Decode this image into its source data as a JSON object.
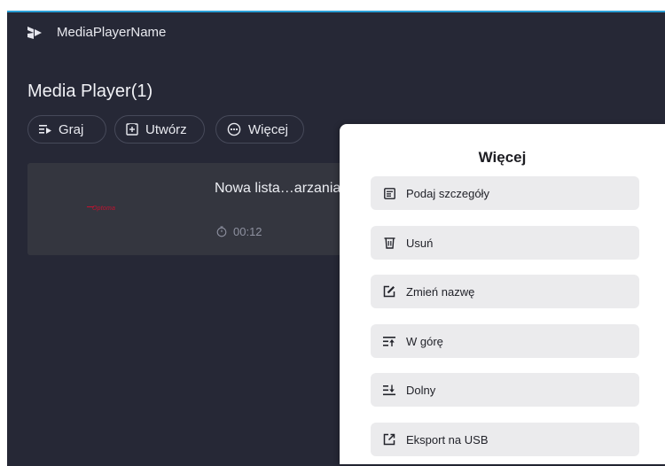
{
  "app": {
    "name": "MediaPlayerName"
  },
  "page": {
    "title": "Media Player(1)"
  },
  "toolbar": {
    "play_label": "Graj",
    "create_label": "Utwórz",
    "more_label": "Więcej"
  },
  "playlist": {
    "items": [
      {
        "brand": "Optoma",
        "title": "Nowa lista…arzania",
        "duration": "00:12"
      }
    ]
  },
  "more_panel": {
    "title": "Więcej",
    "items": [
      {
        "label": "Podaj szczegóły",
        "icon": "details-icon"
      },
      {
        "label": "Usuń",
        "icon": "trash-icon"
      },
      {
        "label": "Zmień nazwę",
        "icon": "rename-icon"
      },
      {
        "label": "W górę",
        "icon": "move-up-icon"
      },
      {
        "label": "Dolny",
        "icon": "move-bottom-icon"
      },
      {
        "label": "Eksport na USB",
        "icon": "export-icon"
      }
    ]
  },
  "colors": {
    "background": "#262836",
    "card": "#34363f",
    "accent_border": "#2a9fd6",
    "menu_item": "#ebebed",
    "brand_red": "#c41230"
  }
}
